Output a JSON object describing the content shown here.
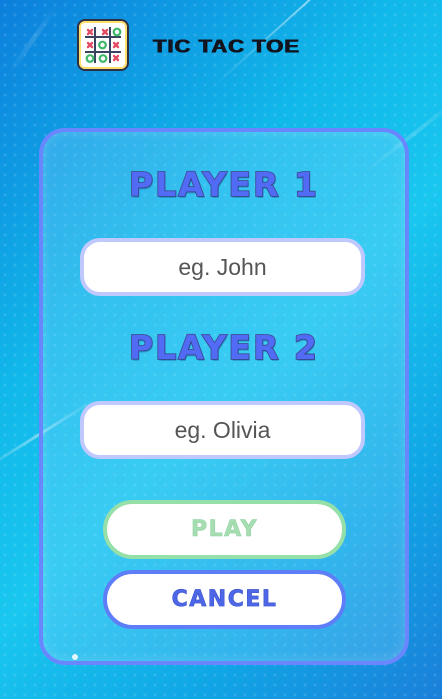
{
  "app": {
    "title": "TIC TAC TOE",
    "logo_icon": "tic-tac-toe-board-icon"
  },
  "form": {
    "player1_label": "PLAYER 1",
    "player1_placeholder": "eg. John",
    "player2_label": "PLAYER 2",
    "player2_placeholder": "eg. Olivia",
    "play_button": "PLAY",
    "cancel_button": "CANCEL"
  },
  "colors": {
    "background_start": "#0c7fdc",
    "background_end": "#1b7fd9",
    "panel_border": "#6a86ff",
    "player_label": "#526bf4",
    "play_border": "#95dfa8",
    "cancel_border": "#5e7ef8"
  }
}
